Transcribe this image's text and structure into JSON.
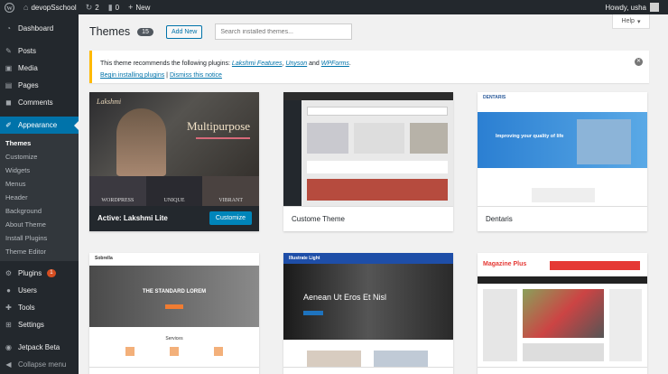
{
  "adminbar": {
    "site_name": "devopSschool",
    "updates_count": "2",
    "comments_count": "0",
    "new_label": "New",
    "greeting": "Howdy, usha"
  },
  "sidebar": {
    "items": [
      {
        "label": "Dashboard",
        "icon": "dashboard-icon"
      },
      {
        "label": "Posts",
        "icon": "pushpin-icon"
      },
      {
        "label": "Media",
        "icon": "media-icon"
      },
      {
        "label": "Pages",
        "icon": "pages-icon"
      },
      {
        "label": "Comments",
        "icon": "comments-icon"
      },
      {
        "label": "Appearance",
        "icon": "brush-icon"
      }
    ],
    "submenu": [
      "Themes",
      "Customize",
      "Widgets",
      "Menus",
      "Header",
      "Background",
      "About Theme",
      "Install Plugins",
      "Theme Editor"
    ],
    "lower": [
      {
        "label": "Plugins",
        "icon": "plugin-icon",
        "badge": "1"
      },
      {
        "label": "Users",
        "icon": "users-icon"
      },
      {
        "label": "Tools",
        "icon": "wrench-icon"
      },
      {
        "label": "Settings",
        "icon": "settings-icon"
      },
      {
        "label": "Jetpack Beta",
        "icon": "jetpack-icon"
      },
      {
        "label": "Collapse menu",
        "icon": "collapse-icon"
      }
    ]
  },
  "help_label": "Help",
  "page": {
    "title": "Themes",
    "count": "15",
    "add_new": "Add New",
    "search_placeholder": "Search installed themes..."
  },
  "notice": {
    "text": "This theme recommends the following plugins:",
    "plugins": [
      "Lakshmi Features",
      "Unyson",
      "WPForms"
    ],
    "begin_link": "Begin installing plugins",
    "separator": "|",
    "dismiss_link": "Dismiss this notice"
  },
  "themes": [
    {
      "name": "Lakshmi Lite",
      "active_prefix": "Active:",
      "button": "Customize",
      "shot_text": {
        "logo": "Lakshmi",
        "headline": "Multipurpose",
        "tiles": [
          "WORDPRESS",
          "UNIQUE",
          "VIBRANT"
        ]
      }
    },
    {
      "name": "Custome Theme"
    },
    {
      "name": "Dentaris",
      "shot_text": {
        "logo": "DENTARIS",
        "banner": "Improving your quality of life"
      }
    },
    {
      "name": "",
      "shot_text": {
        "logo": "Sobrella",
        "banner": "THE STANDARD LOREM",
        "section": "Services"
      }
    },
    {
      "name": "",
      "shot_text": {
        "logo": "Illustrate Light",
        "banner": "Aenean Ut Eros Et Nisl"
      }
    },
    {
      "name": "",
      "shot_text": {
        "logo": "Magazine Plus"
      }
    }
  ],
  "colors": {
    "accent": "#0073aa",
    "adminbar": "#23282d",
    "notice_border": "#ffb900",
    "badge": "#d54e21"
  }
}
